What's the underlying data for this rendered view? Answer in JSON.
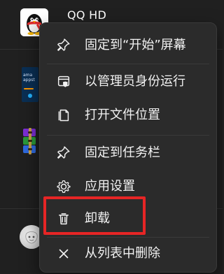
{
  "background": {
    "app_title": "QQ HD",
    "amazon_icon_text": "ama\nappst"
  },
  "context_menu": {
    "items": [
      {
        "label": "固定到“开始”屏幕",
        "icon": "pin-icon"
      },
      {
        "label": "以管理员身份运行",
        "icon": "admin-shield-icon"
      },
      {
        "label": "打开文件位置",
        "icon": "open-file-location-icon"
      },
      {
        "label": "固定到任务栏",
        "icon": "pin-taskbar-icon"
      },
      {
        "label": "应用设置",
        "icon": "settings-gear-icon"
      },
      {
        "label": "卸载",
        "icon": "trash-icon"
      },
      {
        "label": "从列表中删除",
        "icon": "close-icon"
      }
    ]
  },
  "colors": {
    "background": "#202020",
    "menu_bg": "#2b2b2b",
    "menu_border": "#3a3a3a",
    "text": "#f2f2f2",
    "highlight_red": "#e62525"
  }
}
